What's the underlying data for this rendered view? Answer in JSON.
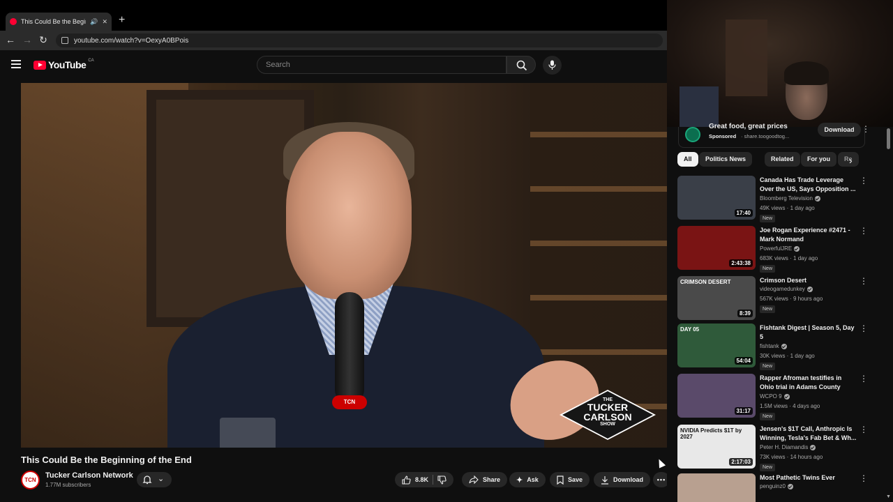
{
  "browser": {
    "tab_title": "This Could Be the Beginning of the End",
    "url": "youtube.com/watch?v=OexyA0BPois",
    "new_tab": "+"
  },
  "header": {
    "logo_text": "YouTube",
    "logo_region": "CA",
    "search_placeholder": "Search"
  },
  "video": {
    "title": "This Could Be the Beginning of the End",
    "overlay_show": [
      "THE",
      "TUCKER",
      "CARLSON",
      "SHOW"
    ],
    "mic_badge": "TCN"
  },
  "channel": {
    "name": "Tucker Carlson Network",
    "subscribers": "1.77M subscribers",
    "avatar_text": "TCN"
  },
  "actions": {
    "likes": "8.8K",
    "share": "Share",
    "ask": "Ask",
    "save": "Save",
    "download": "Download"
  },
  "ad": {
    "title": "Great food, great prices",
    "sponsored": "Sponsored",
    "url": "· share.toogoodtog...",
    "button": "Download"
  },
  "chips": [
    "All",
    "Politics News",
    "Related",
    "For you",
    "Re"
  ],
  "recommendations": [
    {
      "title": "Canada Has Trade Leverage Over the US, Says Opposition ...",
      "channel": "Bloomberg Television",
      "verified": true,
      "meta": "49K views · 1 day ago",
      "badge": "New",
      "duration": "17:40",
      "thumb_color": "#3a3f48"
    },
    {
      "title": "Joe Rogan Experience #2471 - Mark Normand",
      "channel": "PowerfulJRE",
      "verified": true,
      "meta": "683K views · 1 day ago",
      "badge": "New",
      "duration": "2:43:38",
      "thumb_color": "#7a1414"
    },
    {
      "title": "Crimson Desert",
      "channel": "videogamedunkey",
      "verified": true,
      "meta": "567K views · 9 hours ago",
      "badge": "New",
      "duration": "8:39",
      "thumb_color": "#4a4a4a",
      "thumb_text": "CRIMSON DESERT"
    },
    {
      "title": "Fishtank Digest | Season 5, Day 5",
      "channel": "fishtank",
      "verified": true,
      "meta": "30K views · 1 day ago",
      "badge": "New",
      "duration": "54:04",
      "thumb_color": "#2f5a3a",
      "thumb_text": "DAY 05"
    },
    {
      "title": "Rapper Afroman testifies in Ohio trial in Adams County",
      "channel": "WCPO 9",
      "verified": true,
      "meta": "1.5M views · 4 days ago",
      "badge": "New",
      "duration": "31:17",
      "thumb_color": "#5a4a6a"
    },
    {
      "title": "Jensen's $1T Call, Anthropic Is Winning, Tesla's Fab Bet & Wh...",
      "channel": "Peter H. Diamandis",
      "verified": true,
      "meta": "73K views · 14 hours ago",
      "badge": "New",
      "duration": "2:17:03",
      "thumb_color": "#e8e8e8",
      "thumb_text": "NVIDIA Predicts $1T by 2027"
    },
    {
      "title": "Most Pathetic Twins Ever",
      "channel": "penguinz0",
      "verified": true,
      "meta": "",
      "badge": "",
      "duration": "",
      "thumb_color": "#b8a090"
    }
  ]
}
